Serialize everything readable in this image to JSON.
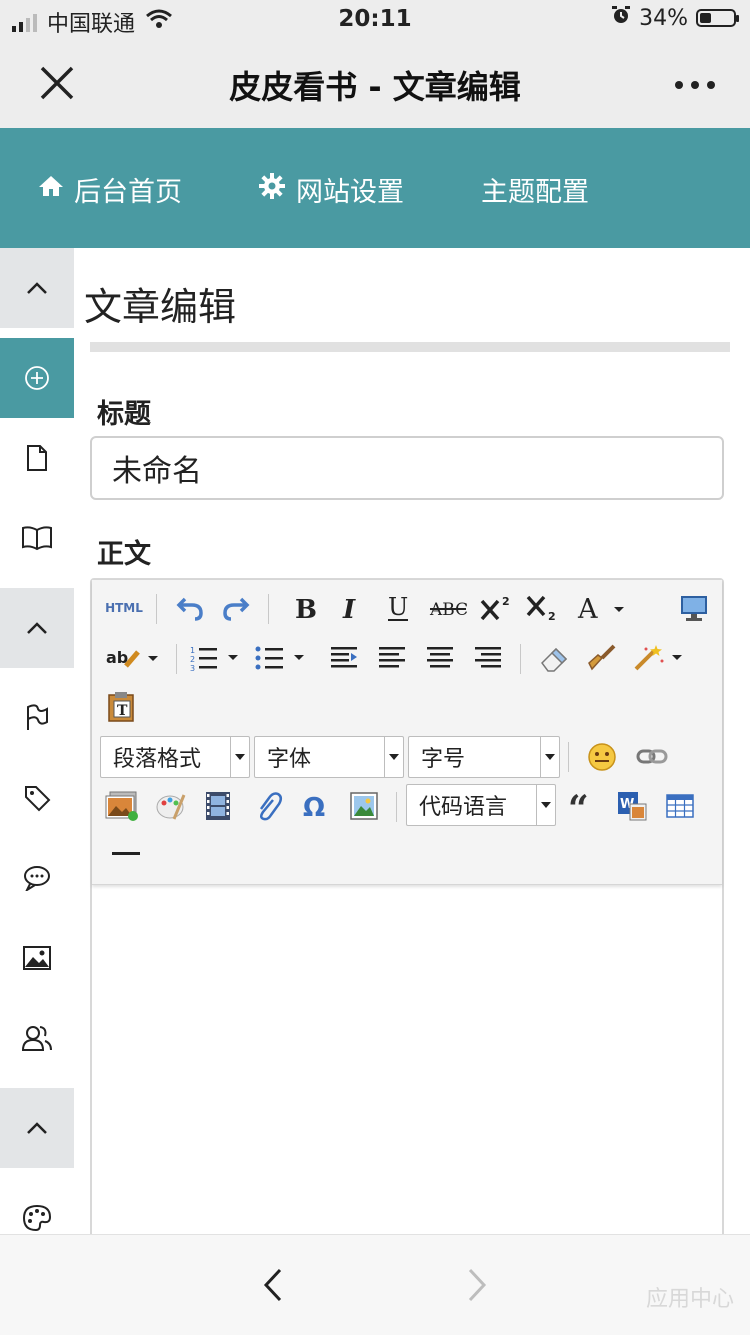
{
  "status_bar": {
    "carrier": "中国联通",
    "time": "20:11",
    "battery_percent": "34%",
    "battery_level": 0.34
  },
  "title_bar": {
    "title": "皮皮看书 - 文章编辑"
  },
  "nav": {
    "items": [
      {
        "label": "后台首页",
        "icon": "home-icon"
      },
      {
        "label": "网站设置",
        "icon": "gear-icon"
      },
      {
        "label": "主题配置",
        "icon": ""
      }
    ]
  },
  "sidebar": {
    "items": [
      "collapse-icon",
      "add-circle-icon",
      "document-icon",
      "book-icon",
      "collapse-icon",
      "flag-icon",
      "tag-icon",
      "chat-icon",
      "image-icon",
      "users-icon",
      "collapse-icon",
      "palette-icon"
    ]
  },
  "main": {
    "heading": "文章编辑",
    "title_label": "标题",
    "title_value": "未命名",
    "body_label": "正文"
  },
  "editor": {
    "html_label": "HTML",
    "paragraph_select": "段落格式",
    "font_select": "字体",
    "size_select": "字号",
    "code_lang_select": "代码语言"
  },
  "watermark": "应用中心",
  "colors": {
    "accent": "#4a9aa2",
    "collapse_bg": "#e3e5e7",
    "bar_bg": "#ededed"
  }
}
